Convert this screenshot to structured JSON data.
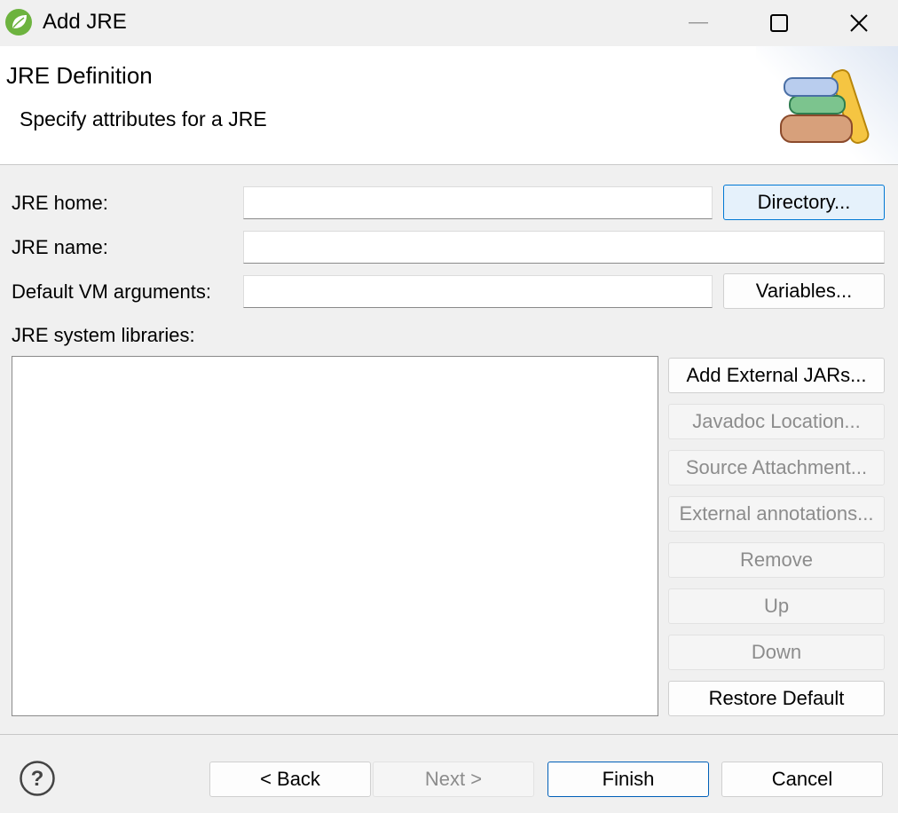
{
  "window": {
    "title": "Add JRE",
    "icon": "spring-leaf-icon",
    "controls": {
      "minimize": "minimize-icon",
      "maximize": "maximize-icon",
      "close": "close-icon"
    }
  },
  "banner": {
    "title": "JRE Definition",
    "subtitle": "Specify attributes for a JRE",
    "image": "books-icon"
  },
  "form": {
    "jre_home": {
      "label": "JRE home:",
      "value": "",
      "button": "Directory..."
    },
    "jre_name": {
      "label": "JRE name:",
      "value": ""
    },
    "vm_args": {
      "label": "Default VM arguments:",
      "value": "",
      "button": "Variables..."
    },
    "libraries_label": "JRE system libraries:"
  },
  "library_buttons": [
    {
      "label": "Add External JARs...",
      "enabled": true
    },
    {
      "label": "Javadoc Location...",
      "enabled": false
    },
    {
      "label": "Source Attachment...",
      "enabled": false
    },
    {
      "label": "External annotations...",
      "enabled": false
    },
    {
      "label": "Remove",
      "enabled": false
    },
    {
      "label": "Up",
      "enabled": false
    },
    {
      "label": "Down",
      "enabled": false
    },
    {
      "label": "Restore Default",
      "enabled": true
    }
  ],
  "footer": {
    "help_icon": "help-icon",
    "back": "< Back",
    "next": "Next >",
    "finish": "Finish",
    "cancel": "Cancel"
  },
  "colors": {
    "accent": "#0078d4",
    "focus_bg": "#e5f1fb",
    "disabled_text": "#8c8c8c"
  }
}
